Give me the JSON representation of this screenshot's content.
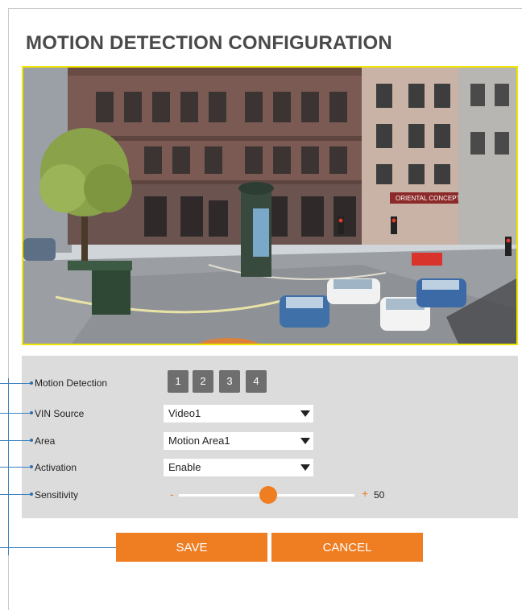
{
  "page": {
    "title": "MOTION DETECTION CONFIGURATION"
  },
  "camera": {
    "sign_text": "ORIENTAL CONCEPTS"
  },
  "settings": {
    "motion_detection": {
      "label": "Motion Detection",
      "areas": [
        "1",
        "2",
        "3",
        "4"
      ]
    },
    "vin_source": {
      "label": "VIN Source",
      "value": "Video1"
    },
    "area": {
      "label": "Area",
      "value": "Motion Area1"
    },
    "activation": {
      "label": "Activation",
      "value": "Enable"
    },
    "sensitivity": {
      "label": "Sensitivity",
      "minus": "-",
      "plus": "+",
      "value": "50",
      "level_percent": 50
    }
  },
  "actions": {
    "save": "SAVE",
    "cancel": "CANCEL"
  },
  "colors": {
    "accent": "#ef7d22",
    "panel": "#dcdcdc",
    "callout": "#3a7fbf",
    "roi_border": "#f2e600"
  }
}
